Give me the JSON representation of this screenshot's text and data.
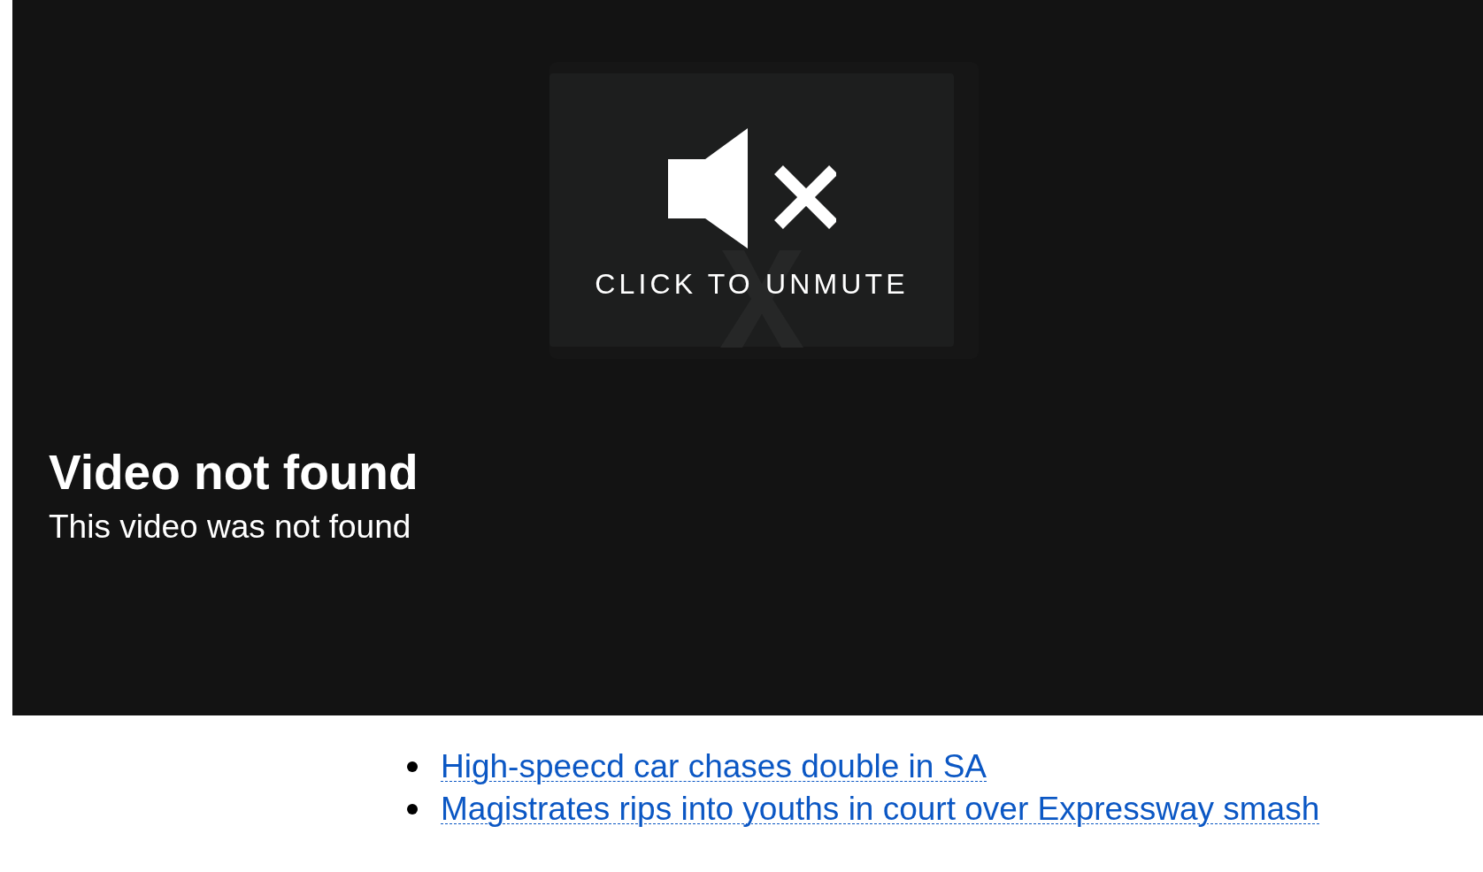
{
  "player": {
    "unmute_label": "CLICK TO UNMUTE",
    "muted": true,
    "error_title": "Video not found",
    "error_message": "This video was not found"
  },
  "related_links": [
    {
      "title": "High-speecd car chases double in SA"
    },
    {
      "title": "Magistrates rips into youths in court over Expressway smash"
    }
  ]
}
